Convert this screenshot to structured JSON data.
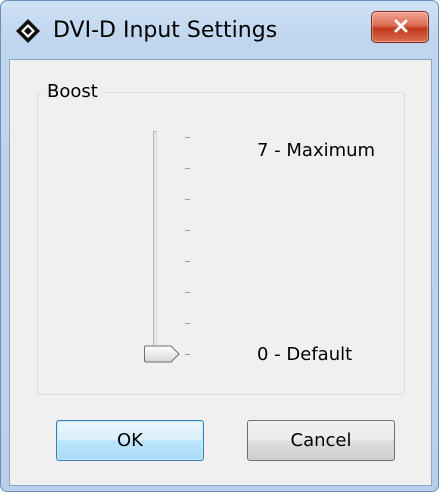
{
  "window": {
    "title": "DVI-D Input Settings",
    "icon": "diamond-app-icon",
    "close_icon": "close-icon"
  },
  "boost": {
    "group_label": "Boost",
    "max_label": "7 - Maximum",
    "min_label": "0 - Default",
    "slider": {
      "min": 0,
      "max": 7,
      "value": 0,
      "tick_count": 8
    }
  },
  "buttons": {
    "ok_label": "OK",
    "cancel_label": "Cancel"
  },
  "colors": {
    "close_button": "#c4371f",
    "default_button_border": "#3c7fb1",
    "client_background": "#f0f0f0"
  }
}
